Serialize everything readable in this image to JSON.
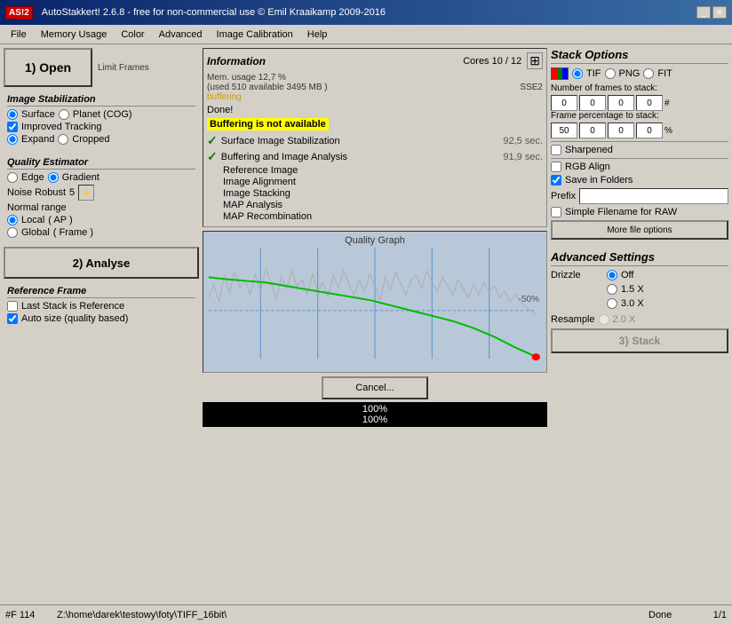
{
  "titleBar": {
    "logo": "AS!2",
    "title": "AutoStakkert! 2.6.8 - free for non-commercial use © Emil Kraaikamp 2009-2016",
    "minimizeBtn": "_",
    "closeBtn": "✕"
  },
  "menuBar": {
    "items": [
      "File",
      "Memory Usage",
      "Color",
      "Advanced",
      "Image Calibration",
      "Help"
    ]
  },
  "leftPanel": {
    "openBtn": "1) Open",
    "limitFrames": "Limit Frames",
    "imageStabilization": {
      "title": "Image Stabilization",
      "surfaceLabel": "Surface",
      "planetLabel": "Planet (COG)",
      "improvedTracking": "Improved Tracking",
      "expandLabel": "Expand",
      "croppedLabel": "Cropped"
    },
    "qualityEstimator": {
      "title": "Quality Estimator",
      "edgeLabel": "Edge",
      "gradientLabel": "Gradient",
      "noiseRobustLabel": "Noise Robust",
      "noiseRobustValue": "5",
      "normalRangeLabel": "Normal range",
      "localLabel": "Local",
      "localAP": "( AP )",
      "globalLabel": "Global",
      "globalFrame": "( Frame )"
    },
    "analyseBtn": "2) Analyse",
    "referenceFrame": {
      "title": "Reference Frame",
      "lastStackLabel": "Last Stack is Reference",
      "autoSizeLabel": "Auto size (quality based)"
    }
  },
  "middlePanel": {
    "information": {
      "title": "Information",
      "coresLabel": "Cores 10 / 12",
      "memUsage": "Mem. usage 12,7 %",
      "memDetail": "(used 510 available 3495 MB )",
      "sse2": "SSE2",
      "buffering": "buffering",
      "done": "Done!",
      "bufferingWarn": "Buffering is not available",
      "tasks": [
        {
          "checked": true,
          "label": "Surface Image Stabilization",
          "time": "92,5 sec."
        },
        {
          "checked": true,
          "label": "Buffering and Image Analysis",
          "time": "91,9 sec."
        },
        {
          "checked": false,
          "label": "Reference Image",
          "time": ""
        },
        {
          "checked": false,
          "label": "Image Alignment",
          "time": ""
        },
        {
          "checked": false,
          "label": "Image Stacking",
          "time": ""
        },
        {
          "checked": false,
          "label": "MAP Analysis",
          "time": ""
        },
        {
          "checked": false,
          "label": "MAP Recombination",
          "time": ""
        }
      ]
    },
    "qualityGraph": {
      "title": "Quality Graph",
      "percent50": "-50%"
    },
    "cancelBtn": "Cancel...",
    "progress1": "100%",
    "progress2": "100%"
  },
  "rightPanel": {
    "stackOptions": {
      "title": "Stack Options",
      "tifLabel": "TIF",
      "pngLabel": "PNG",
      "fitLabel": "FIT",
      "numFramesLabel": "Number of frames to stack:",
      "numFrames": [
        "0",
        "0",
        "0",
        "0"
      ],
      "numFrameUnit": "#",
      "framePctLabel": "Frame percentage to stack:",
      "framePct": [
        "50",
        "0",
        "0",
        "0"
      ],
      "framePctUnit": "%",
      "sharpened": "Sharpened",
      "rgbAlign": "RGB Align",
      "saveInFolders": "Save in Folders",
      "prefix": "Prefix",
      "simpleFilename": "Simple Filename for RAW",
      "moreFileOptions": "More file options"
    },
    "advancedSettings": {
      "title": "Advanced Settings",
      "drizzle": "Drizzle",
      "off": "Off",
      "drizzle15x": "1.5 X",
      "drizzle30x": "3.0 X",
      "resample": "Resample",
      "resample20x": "2.0 X",
      "stackBtn": "3} Stack"
    }
  },
  "statusBar": {
    "frame": "#F 114",
    "path": "Z:\\home\\darek\\testowy\\foty\\TIFF_16bit\\",
    "done": "Done",
    "page": "1/1"
  }
}
